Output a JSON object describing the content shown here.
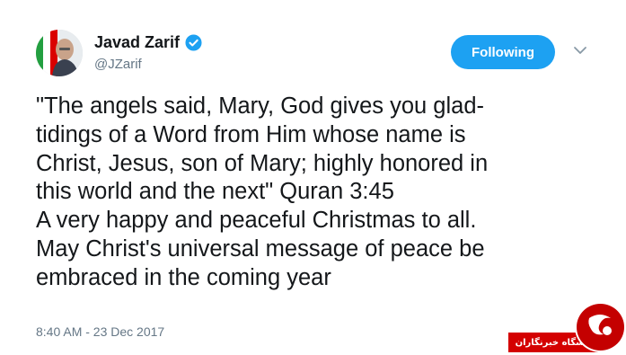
{
  "tweet": {
    "author_name": "Javad Zarif",
    "handle": "@JZarif",
    "follow_label": "Following",
    "text_lines": [
      "\"The angels said, Mary, God gives you glad-",
      "tidings of a Word from Him whose name is",
      "Christ, Jesus, son of Mary; highly honored in",
      "this world and the next\" Quran 3:45",
      "A very happy and peaceful Christmas to all.",
      "May Christ's universal message of peace be",
      "embraced in the coming year"
    ],
    "timestamp": "8:40 AM - 23 Dec 2017"
  },
  "watermark": {
    "text": "باشگاه خبرنگاران"
  },
  "icons": {
    "verified": "verified-badge-icon",
    "caret": "chevron-down-icon"
  },
  "colors": {
    "accent": "#1da1f2",
    "text": "#14171a",
    "secondary": "#657786",
    "watermark": "#d40000"
  }
}
